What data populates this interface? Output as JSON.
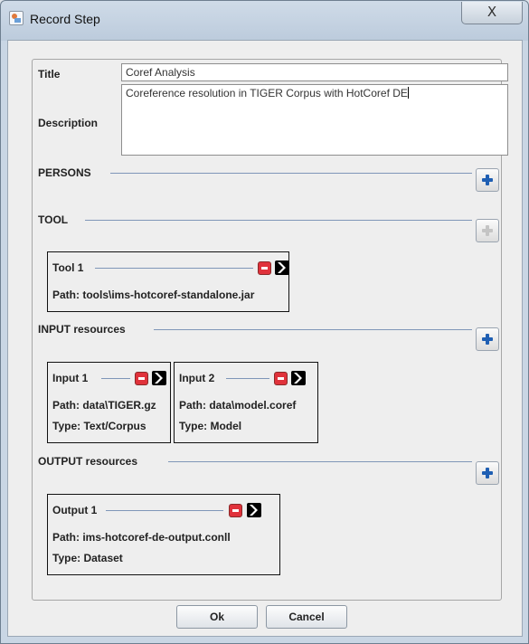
{
  "window": {
    "title": "Record Step",
    "close_glyph": "X"
  },
  "form": {
    "title_label": "Title",
    "title_value": "Coref Analysis",
    "description_label": "Description",
    "description_value": "Coreference resolution in TIGER Corpus with HotCoref DE"
  },
  "sections": {
    "persons": "PERSONS",
    "tool": "TOOL",
    "input": "INPUT resources",
    "output": "OUTPUT resources"
  },
  "tools": [
    {
      "name": "Tool 1",
      "path": "Path: tools\\ims-hotcoref-standalone.jar"
    }
  ],
  "inputs": [
    {
      "name": "Input 1",
      "path": "Path: data\\TIGER.gz",
      "type": "Type: Text/Corpus"
    },
    {
      "name": "Input 2",
      "path": "Path: data\\model.coref",
      "type": "Type: Model"
    }
  ],
  "outputs": [
    {
      "name": "Output 1",
      "path": "Path: ims-hotcoref-de-output.conll",
      "type": "Type: Dataset"
    }
  ],
  "buttons": {
    "ok": "Ok",
    "cancel": "Cancel"
  },
  "icons": {
    "add": "plus-icon",
    "remove": "minus-icon",
    "open": "arrow-right-icon",
    "close": "close-icon"
  },
  "colors": {
    "add_icon": "#1f5fb3",
    "remove_icon": "#e0323b",
    "separator": "#7f96b8"
  }
}
